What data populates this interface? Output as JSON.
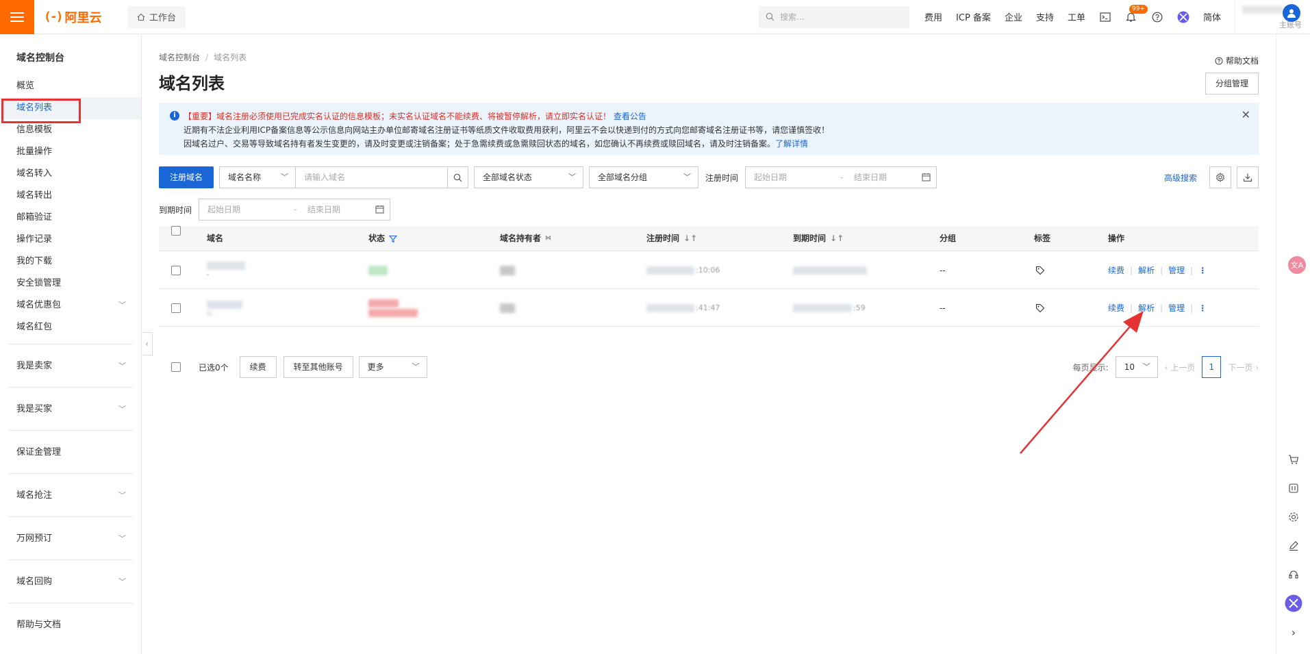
{
  "topbar": {
    "logo_mark": "(-)",
    "logo_text": "阿里云",
    "workbench": "工作台",
    "search_placeholder": "搜索...",
    "links": [
      "费用",
      "ICP 备案",
      "企业",
      "支持",
      "工单"
    ],
    "notification_badge": "99+",
    "lang": "简体",
    "sub_account": "主账号"
  },
  "sidebar": {
    "title": "域名控制台",
    "items": [
      {
        "label": "概览"
      },
      {
        "label": "域名列表",
        "active": true
      },
      {
        "label": "信息模板"
      },
      {
        "label": "批量操作"
      },
      {
        "label": "域名转入"
      },
      {
        "label": "域名转出"
      },
      {
        "label": "邮箱验证"
      },
      {
        "label": "操作记录"
      },
      {
        "label": "我的下载"
      },
      {
        "label": "安全锁管理"
      },
      {
        "label": "域名优惠包"
      },
      {
        "label": "域名红包"
      }
    ],
    "groups": [
      "我是卖家",
      "我是买家",
      "保证金管理",
      "域名抢注",
      "万网预订",
      "域名回购",
      "帮助与文档"
    ]
  },
  "main": {
    "breadcrumb": [
      "域名控制台",
      "域名列表"
    ],
    "title": "域名列表",
    "help_doc": "帮助文档",
    "group_manage": "分组管理",
    "notice": {
      "line1_warn": "【重要】域名注册必须使用已完成实名认证的信息模板；未实名认证域名不能续费、将被暂停解析，请立即实名认证！",
      "line1_link": "查看公告",
      "line2": "近期有不法企业利用ICP备案信息等公示信息向网站主办单位邮寄域名注册证书等纸质文件收取费用获利，阿里云不会以快递到付的方式向您邮寄域名注册证书等，请您谨慎签收！",
      "line3": "因域名过户、交易等导致域名持有者发生变更的，请及时变更或注销备案；处于急需续费或急需赎回状态的域名，如您确认不再续费或赎回域名，请及时注销备案。",
      "line3_link": "了解详情"
    },
    "filters": {
      "register_btn": "注册域名",
      "name_select": "域名名称",
      "name_placeholder": "请输入域名",
      "status_select": "全部域名状态",
      "group_select": "全部域名分组",
      "reg_time_label": "注册时间",
      "start_date": "起始日期",
      "end_date": "结束日期",
      "advanced": "高级搜索",
      "expire_label": "到期时间"
    },
    "table": {
      "headers": [
        "域名",
        "状态",
        "域名持有者",
        "注册时间",
        "到期时间",
        "分组",
        "标签",
        "操作"
      ],
      "rows": [
        {
          "group": "--",
          "reg_suffix": ":10:06",
          "ops": [
            "续费",
            "解析",
            "管理"
          ]
        },
        {
          "group": "--",
          "reg_suffix": ":41:47",
          "exp_suffix": ":59",
          "ops": [
            "续费",
            "解析",
            "管理"
          ]
        }
      ]
    },
    "footer": {
      "selected": "已选0个",
      "renew": "续费",
      "transfer": "转至其他账号",
      "more": "更多",
      "per_page_label": "每页显示:",
      "per_page": "10",
      "prev": "上一页",
      "page": "1",
      "next": "下一页"
    }
  },
  "rail": {
    "translate": "文A"
  },
  "colors": {
    "brand": "#ff6a00",
    "link": "#1a66d6",
    "warn": "#d93026",
    "annotation": "#e53333"
  }
}
